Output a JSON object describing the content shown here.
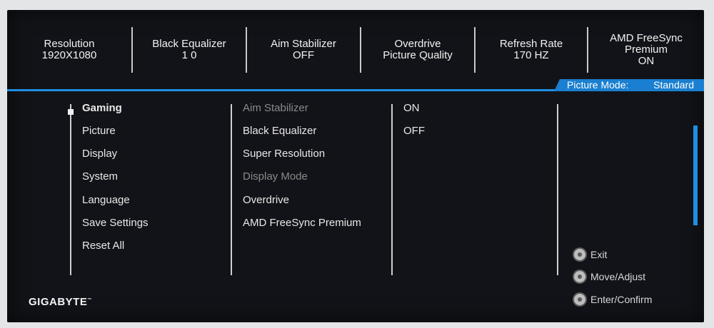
{
  "status_bar": [
    {
      "label": "Resolution",
      "value": "1920X1080"
    },
    {
      "label": "Black Equalizer",
      "value": "1 0"
    },
    {
      "label": "Aim Stabilizer",
      "value": "OFF"
    },
    {
      "label": "Overdrive",
      "value": "Picture Quality"
    },
    {
      "label": "Refresh Rate",
      "value": "170 HZ"
    },
    {
      "label": "AMD FreeSync",
      "label2": "Premium",
      "value": "ON"
    }
  ],
  "picture_mode": {
    "label": "Picture Mode:",
    "value": "Standard"
  },
  "main_menu": [
    "Gaming",
    "Picture",
    "Display",
    "System",
    "Language",
    "Save Settings",
    "Reset All"
  ],
  "sub_menu": [
    {
      "label": "Aim Stabilizer",
      "disabled": true
    },
    {
      "label": "Black Equalizer",
      "disabled": false
    },
    {
      "label": "Super Resolution",
      "disabled": false
    },
    {
      "label": "Display Mode",
      "disabled": true
    },
    {
      "label": "Overdrive",
      "disabled": false
    },
    {
      "label": "AMD FreeSync Premium",
      "disabled": false
    }
  ],
  "options": [
    "ON",
    "OFF"
  ],
  "hints": [
    "Exit",
    "Move/Adjust",
    "Enter/Confirm"
  ],
  "brand": {
    "logo": "GIGABYTE",
    "tm": "™"
  },
  "colors": {
    "accent": "#1f8fe0",
    "background": "#121318"
  }
}
